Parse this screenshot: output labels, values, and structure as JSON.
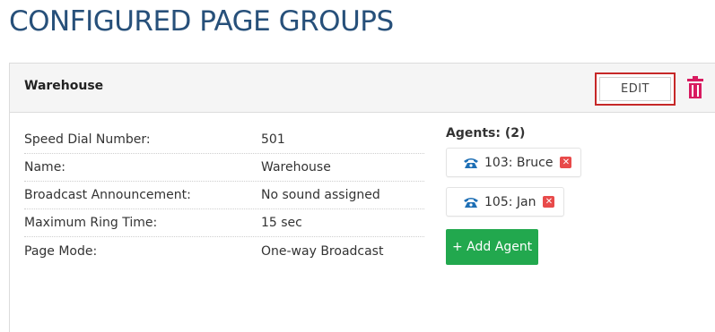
{
  "page": {
    "title": "CONFIGURED PAGE GROUPS"
  },
  "group": {
    "name": "Warehouse",
    "edit_label": "EDIT",
    "details": [
      {
        "label": "Speed Dial Number:",
        "value": "501"
      },
      {
        "label": "Name:",
        "value": "Warehouse"
      },
      {
        "label": "Broadcast Announcement:",
        "value": "No sound assigned"
      },
      {
        "label": "Maximum Ring Time:",
        "value": "15 sec"
      },
      {
        "label": "Page Mode:",
        "value": "One-way Broadcast"
      }
    ],
    "agents_heading": "Agents: (2)",
    "agents": [
      {
        "label": "103: Bruce"
      },
      {
        "label": "105: Jan"
      }
    ],
    "add_agent_label": "+ Add Agent"
  },
  "icons": {
    "trash": "trash-icon",
    "phone": "phone-icon",
    "remove": "remove-icon"
  },
  "colors": {
    "title": "#27507a",
    "edit_highlight": "#c62828",
    "trash": "#d81b60",
    "phone": "#1e6fb5",
    "remove": "#e84a4a",
    "add_button": "#22a84e"
  }
}
